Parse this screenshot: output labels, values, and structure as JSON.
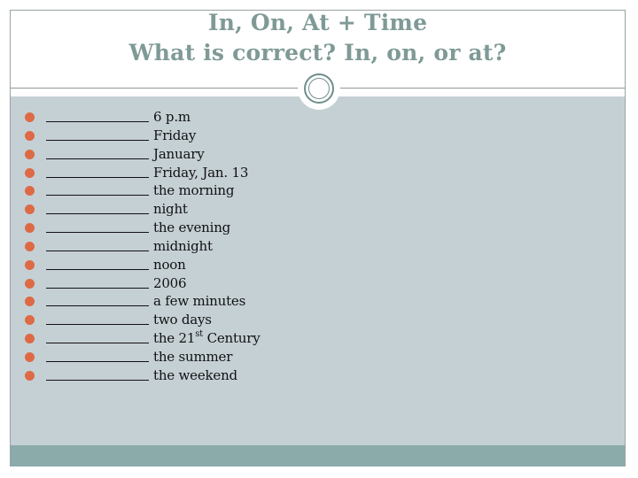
{
  "slide": {
    "title": {
      "line1": "In, On, At + Time",
      "line2": "What is correct? In, on, or at?"
    },
    "blank_placeholder": "__________",
    "items": [
      {
        "text": "6 p.m"
      },
      {
        "text": "Friday"
      },
      {
        "text": "January"
      },
      {
        "text": "Friday, Jan. 13"
      },
      {
        "text": "the morning"
      },
      {
        "text": "night"
      },
      {
        "text": "the evening"
      },
      {
        "text": "midnight"
      },
      {
        "text": "noon"
      },
      {
        "text": "2006"
      },
      {
        "text": "a few minutes"
      },
      {
        "text": "two days"
      },
      {
        "text": "the 21",
        "sup": "st",
        "after": " Century"
      },
      {
        "text": "the summer"
      },
      {
        "text": "the weekend"
      }
    ],
    "colors": {
      "title": "#7f9a96",
      "content_bg": "#c5d0d5",
      "footer_band": "#8aaba9",
      "bullet": "#dd6a45",
      "ornament_ring": "#6f8e8b"
    },
    "icons": {
      "ornament": "double-ring-circle-icon",
      "bullet": "filled-circle-bullet-icon"
    }
  }
}
